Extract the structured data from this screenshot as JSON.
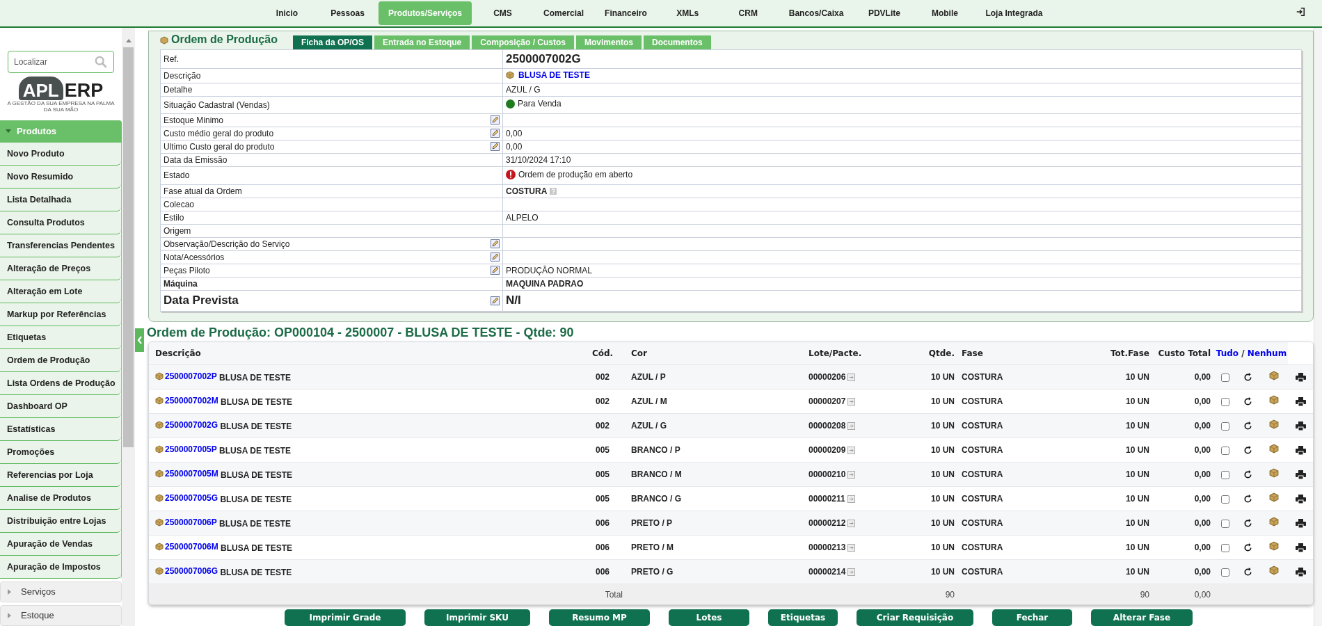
{
  "nav": {
    "items": [
      {
        "label": "Inicio",
        "selected": false
      },
      {
        "label": "Pessoas",
        "selected": false
      },
      {
        "label": "Produtos/Serviços",
        "selected": true
      },
      {
        "label": "CMS",
        "selected": false
      },
      {
        "label": "Comercial",
        "selected": false
      },
      {
        "label": "Financeiro",
        "selected": false
      },
      {
        "label": "XMLs",
        "selected": false
      },
      {
        "label": "CRM",
        "selected": false
      },
      {
        "label": "Bancos/Caixa",
        "selected": false
      },
      {
        "label": "PDVLite",
        "selected": false
      },
      {
        "label": "Mobile",
        "selected": false
      },
      {
        "label": "Loja Integrada",
        "selected": false
      }
    ]
  },
  "sidebar": {
    "search": {
      "placeholder": "Localizar"
    },
    "logo": {
      "left": "APL",
      "right": "ERP",
      "tagline": "A GESTÃO DA SUA EMPRESA NA PALMA DA SUA MÃO"
    },
    "groups": [
      {
        "label": "Produtos",
        "expanded": true,
        "children": [
          {
            "label": "Novo Produto"
          },
          {
            "label": "Novo Resumido"
          },
          {
            "label": "Lista Detalhada"
          },
          {
            "label": "Consulta Produtos"
          },
          {
            "label": "Transferencias Pendentes"
          },
          {
            "label": "Alteração de Preços"
          },
          {
            "label": "Alteração em Lote"
          },
          {
            "label": "Markup por Referências"
          },
          {
            "label": "Etiquetas"
          },
          {
            "label": "Ordem de Produção"
          },
          {
            "label": "Lista Ordens de Produção"
          },
          {
            "label": "Dashboard OP"
          },
          {
            "label": "Estatísticas"
          },
          {
            "label": "Promoções"
          },
          {
            "label": "Referencias por Loja"
          },
          {
            "label": "Analise de Produtos"
          },
          {
            "label": "Distribuição entre Lojas"
          },
          {
            "label": "Apuração de Vendas"
          },
          {
            "label": "Apuração de Impostos"
          }
        ]
      },
      {
        "label": "Serviços",
        "expanded": false
      },
      {
        "label": "Estoque",
        "expanded": false
      }
    ]
  },
  "panel": {
    "title": "Ordem de Produção",
    "tabs": [
      {
        "label": "Ficha da OP/OS",
        "selected": true
      },
      {
        "label": "Entrada no Estoque",
        "selected": false
      },
      {
        "label": "Composição / Custos",
        "selected": false
      },
      {
        "label": "Movimentos",
        "selected": false
      },
      {
        "label": "Documentos",
        "selected": false
      }
    ],
    "details": [
      {
        "label": "Ref.",
        "value": "2500007002G",
        "kind": "ref",
        "editable": false
      },
      {
        "label": "Descrição",
        "value": "BLUSA DE TESTE",
        "kind": "product",
        "editable": false
      },
      {
        "label": "Detalhe",
        "value": "AZUL / G",
        "kind": "text",
        "editable": false
      },
      {
        "label": "Situação Cadastral (Vendas)",
        "value": "Para Venda",
        "kind": "dot",
        "color": "#1e7b1e",
        "editable": false
      },
      {
        "label": "Estoque Minimo",
        "kind": "text",
        "editable": true
      },
      {
        "label": "Custo médio geral do produto",
        "value": "0,00",
        "kind": "text",
        "editable": true
      },
      {
        "label": "Ultimo Custo geral do produto",
        "value": "0,00",
        "kind": "text",
        "editable": true
      },
      {
        "label": "Data da Emissão",
        "value": "31/10/2024 17:10",
        "kind": "text",
        "editable": false
      },
      {
        "label": "Estado",
        "value": "Ordem de produção em aberto",
        "kind": "alert",
        "editable": false
      },
      {
        "label": "Fase atual da Ordem",
        "value": "COSTURA",
        "kind": "phase",
        "editable": false
      },
      {
        "label": "Colecao",
        "kind": "text",
        "editable": false
      },
      {
        "label": "Estilo",
        "value": "ALPELO",
        "kind": "text",
        "editable": false
      },
      {
        "label": "Origem",
        "kind": "text",
        "editable": false
      },
      {
        "label": "Observação/Descrição do Serviço",
        "kind": "text",
        "editable": true
      },
      {
        "label": "Nota/Acessórios",
        "kind": "text",
        "editable": true
      },
      {
        "label": "Peças Piloto",
        "value": "PRODUÇÃO NORMAL",
        "kind": "text",
        "editable": true
      },
      {
        "label": "Máquina",
        "value": "MAQUINA PADRAO",
        "kind": "strong",
        "editable": false
      },
      {
        "label": "Data Prevista",
        "value": "N/I",
        "kind": "large",
        "editable": true
      }
    ]
  },
  "order": {
    "heading": "Ordem de Produção: OP000104 - 2500007 - BLUSA DE TESTE - Qtde: 90",
    "columns": [
      "Descrição",
      "Cód.",
      "Cor",
      "Lote/Pacte.",
      "Qtde.",
      "Fase",
      "Tot.Fase",
      "Custo Total"
    ],
    "select_links": {
      "all": "Tudo",
      "separator": "/",
      "none": "Nenhum"
    },
    "rows": [
      {
        "code": "2500007002P",
        "name": "BLUSA DE TESTE",
        "cod": "002",
        "cor": "AZUL / P",
        "lote": "00000206",
        "qtde": "10 UN",
        "fase": "COSTURA",
        "tot_fase": "10 UN",
        "custo": "0,00",
        "checked": false
      },
      {
        "code": "2500007002M",
        "name": "BLUSA DE TESTE",
        "cod": "002",
        "cor": "AZUL / M",
        "lote": "00000207",
        "qtde": "10 UN",
        "fase": "COSTURA",
        "tot_fase": "10 UN",
        "custo": "0,00",
        "checked": false
      },
      {
        "code": "2500007002G",
        "name": "BLUSA DE TESTE",
        "cod": "002",
        "cor": "AZUL / G",
        "lote": "00000208",
        "qtde": "10 UN",
        "fase": "COSTURA",
        "tot_fase": "10 UN",
        "custo": "0,00",
        "checked": false
      },
      {
        "code": "2500007005P",
        "name": "BLUSA DE TESTE",
        "cod": "005",
        "cor": "BRANCO / P",
        "lote": "00000209",
        "qtde": "10 UN",
        "fase": "COSTURA",
        "tot_fase": "10 UN",
        "custo": "0,00",
        "checked": false
      },
      {
        "code": "2500007005M",
        "name": "BLUSA DE TESTE",
        "cod": "005",
        "cor": "BRANCO / M",
        "lote": "00000210",
        "qtde": "10 UN",
        "fase": "COSTURA",
        "tot_fase": "10 UN",
        "custo": "0,00",
        "checked": false
      },
      {
        "code": "2500007005G",
        "name": "BLUSA DE TESTE",
        "cod": "005",
        "cor": "BRANCO / G",
        "lote": "00000211",
        "qtde": "10 UN",
        "fase": "COSTURA",
        "tot_fase": "10 UN",
        "custo": "0,00",
        "checked": false
      },
      {
        "code": "2500007006P",
        "name": "BLUSA DE TESTE",
        "cod": "006",
        "cor": "PRETO / P",
        "lote": "00000212",
        "qtde": "10 UN",
        "fase": "COSTURA",
        "tot_fase": "10 UN",
        "custo": "0,00",
        "checked": false
      },
      {
        "code": "2500007006M",
        "name": "BLUSA DE TESTE",
        "cod": "006",
        "cor": "PRETO / M",
        "lote": "00000213",
        "qtde": "10 UN",
        "fase": "COSTURA",
        "tot_fase": "10 UN",
        "custo": "0,00",
        "checked": false
      },
      {
        "code": "2500007006G",
        "name": "BLUSA DE TESTE",
        "cod": "006",
        "cor": "PRETO / G",
        "lote": "00000214",
        "qtde": "10 UN",
        "fase": "COSTURA",
        "tot_fase": "10 UN",
        "custo": "0,00",
        "checked": false
      }
    ],
    "total": {
      "label": "Total",
      "qtde": "90",
      "tot_fase": "90",
      "custo": "0,00"
    }
  },
  "buttons": [
    "Imprimir Grade",
    "Imprimir SKU",
    "Resumo MP",
    "Lotes",
    "Etiquetas",
    "Criar Requisição",
    "Fechar",
    "Alterar Fase"
  ]
}
